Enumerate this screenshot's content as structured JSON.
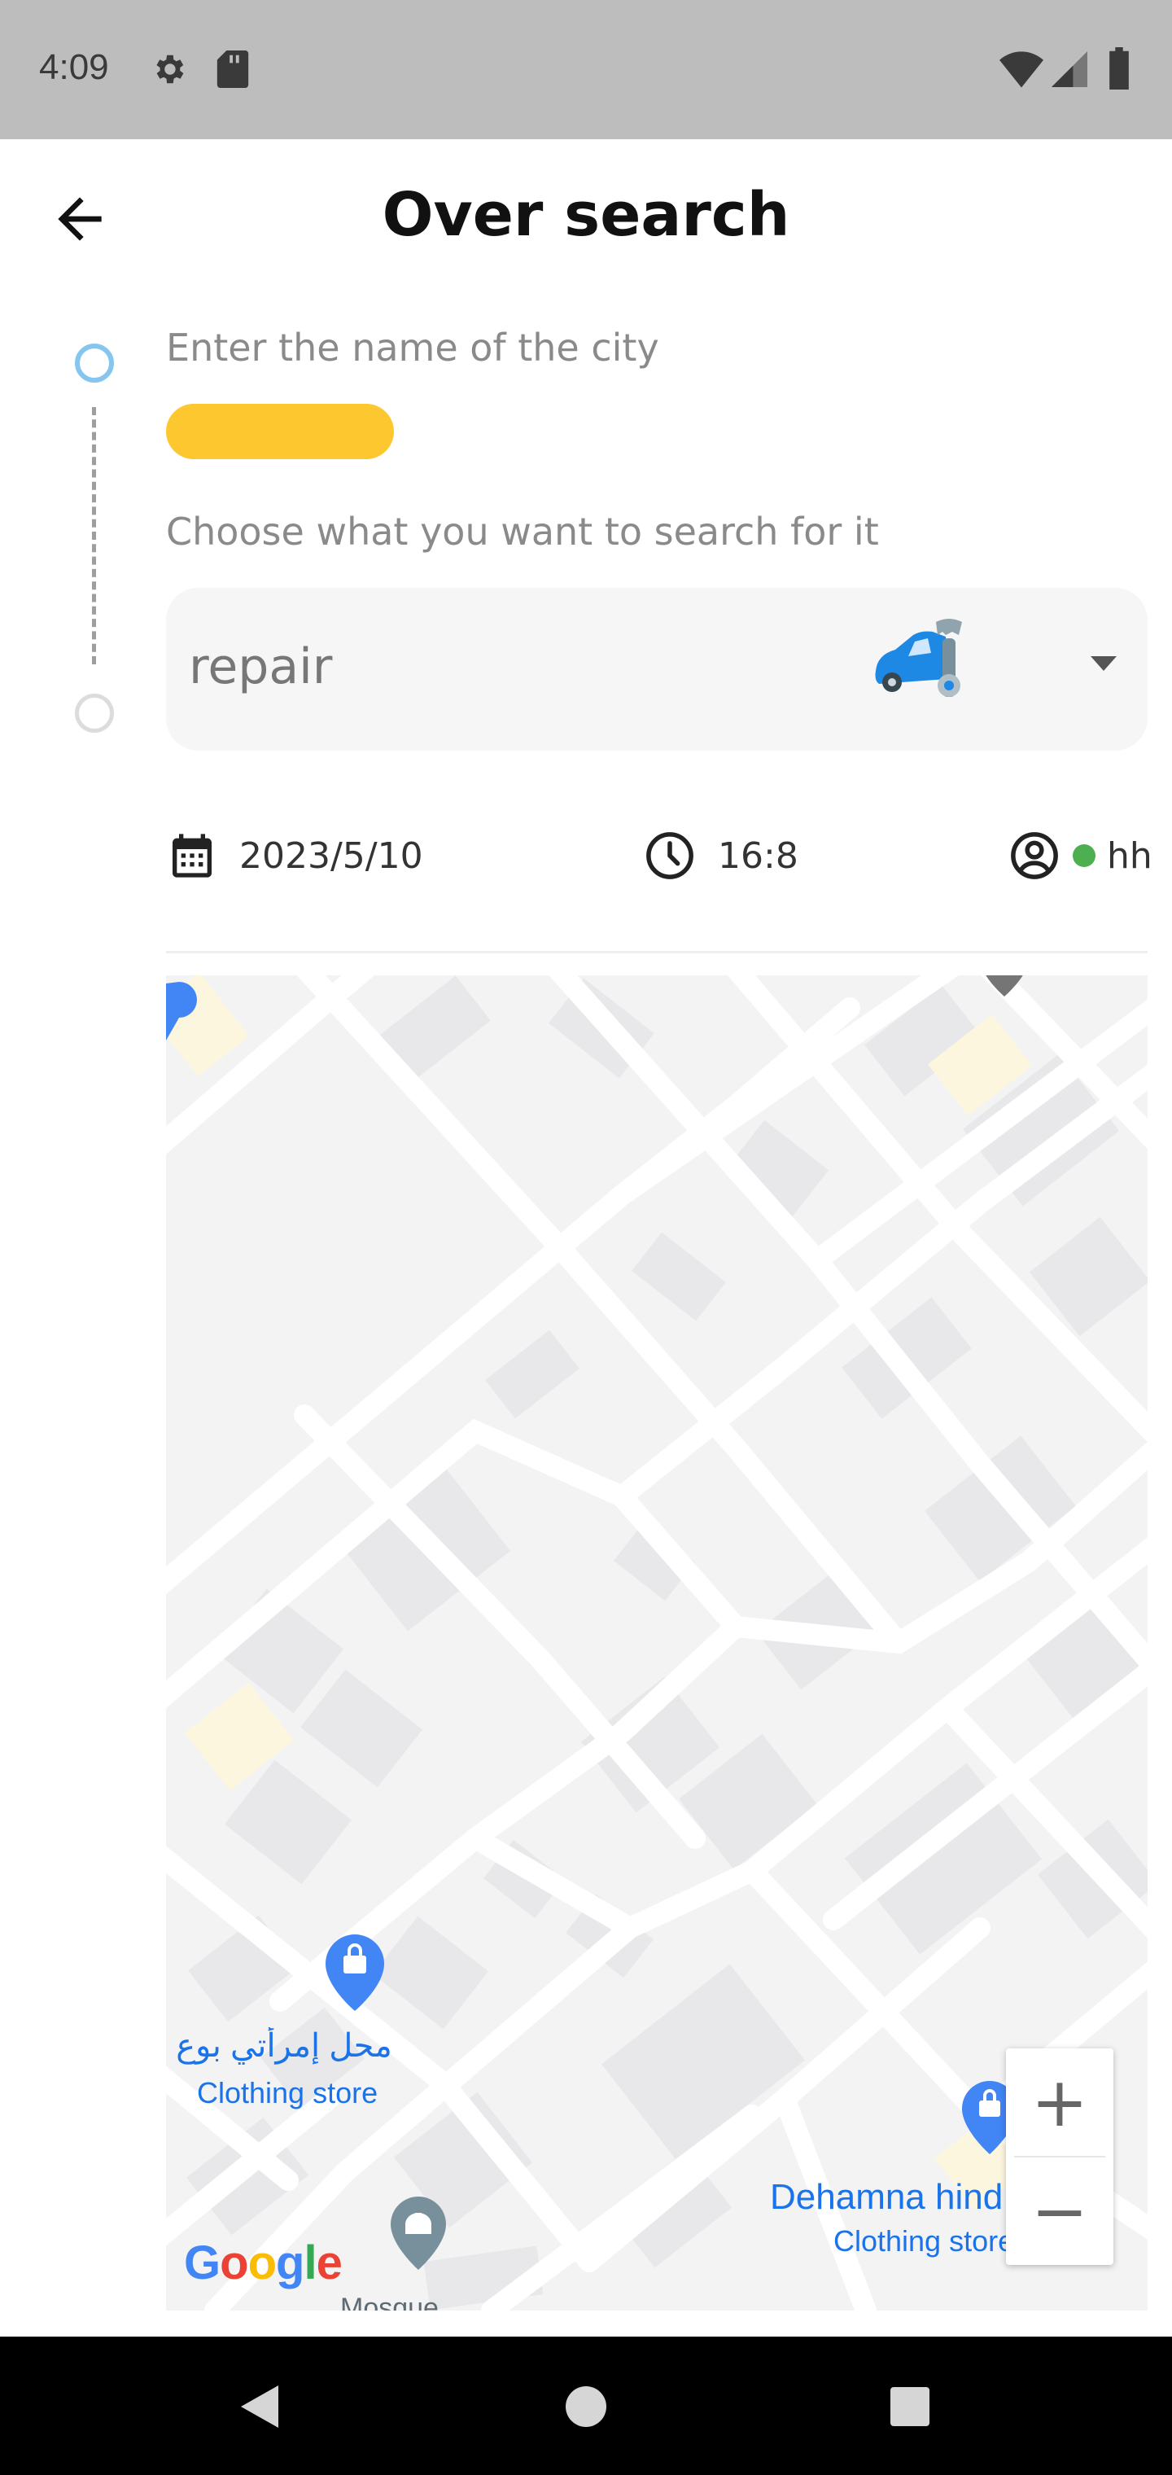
{
  "status_bar": {
    "time": "4:09",
    "icons": [
      "gear-icon",
      "sd-card-icon",
      "wifi-icon",
      "cell-signal-icon",
      "battery-icon"
    ]
  },
  "header": {
    "title": "Over search",
    "back_icon": "arrow-back-icon"
  },
  "form": {
    "city_label": "Enter the name of the city",
    "city_value_color": "#fdc72f",
    "search_label": "Choose what you want to search for it",
    "search_select": {
      "value": "repair",
      "icon": "car-repair-icon",
      "caret": "dropdown-caret-icon"
    }
  },
  "info": {
    "date": "2023/5/10",
    "time": "16:8",
    "user": "hh",
    "status_color": "#4caf50"
  },
  "map": {
    "labels": {
      "shop1_name": "محل إمرأتي بوع",
      "shop1_type": "Clothing store",
      "shop2_name": "Dehamna hind",
      "shop2_type": "Clothing store",
      "mosque": "Mosque"
    },
    "zoom_in": "+",
    "zoom_out": "−",
    "logo_letters": [
      "G",
      "o",
      "o",
      "g",
      "l",
      "e"
    ]
  },
  "nav_bar": {
    "icons": [
      "back-triangle-icon",
      "home-circle-icon",
      "recents-square-icon"
    ]
  }
}
